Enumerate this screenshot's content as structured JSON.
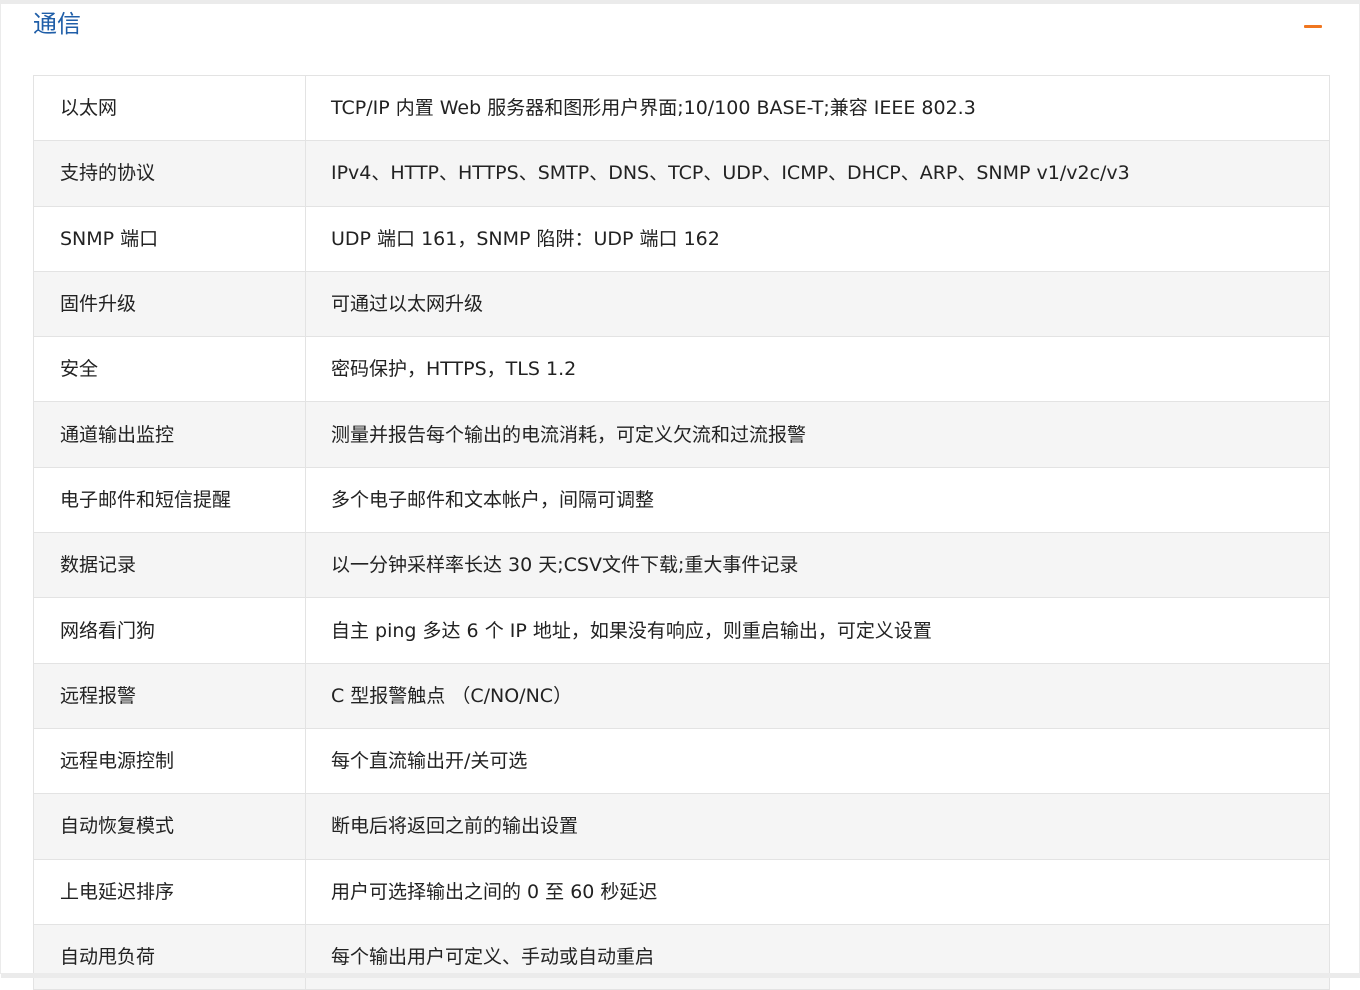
{
  "section": {
    "title": "通信",
    "collapse_symbol": "−"
  },
  "rows": [
    {
      "key": "以太网",
      "value": "TCP/IP 内置 Web 服务器和图形用户界面;10/100 BASE-T;兼容 IEEE 802.3"
    },
    {
      "key": "支持的协议",
      "value": "IPv4、HTTP、HTTPS、SMTP、DNS、TCP、UDP、ICMP、DHCP、ARP、SNMP v1/v2c/v3"
    },
    {
      "key": "SNMP 端口",
      "value": "UDP 端口 161，SNMP 陷阱：UDP 端口 162"
    },
    {
      "key": "固件升级",
      "value": "可通过以太网升级"
    },
    {
      "key": "安全",
      "value": "密码保护，HTTPS，TLS 1.2"
    },
    {
      "key": "通道输出监控",
      "value": "测量并报告每个输出的电流消耗，可定义欠流和过流报警"
    },
    {
      "key": "电子邮件和短信提醒",
      "value": "多个电子邮件和文本帐户，间隔可调整"
    },
    {
      "key": "数据记录",
      "value": "以一分钟采样率长达 30 天;CSV文件下载;重大事件记录"
    },
    {
      "key": "网络看门狗",
      "value": "自主 ping 多达 6 个 IP 地址，如果没有响应，则重启输出，可定义设置"
    },
    {
      "key": "远程报警",
      "value": "C 型报警触点 （C/NO/NC）"
    },
    {
      "key": "远程电源控制",
      "value": "每个直流输出开/关可选"
    },
    {
      "key": "自动恢复模式",
      "value": "断电后将返回之前的输出设置"
    },
    {
      "key": "上电延迟排序",
      "value": "用户可选择输出之间的 0 至 60 秒延迟"
    },
    {
      "key": "自动甩负荷",
      "value": "每个输出用户可定义、手动或自动重启"
    }
  ],
  "colors": {
    "title": "#1f5ea8",
    "accent": "#f0761f",
    "row_alt": "#f5f5f5",
    "border": "#e3e3e3"
  }
}
